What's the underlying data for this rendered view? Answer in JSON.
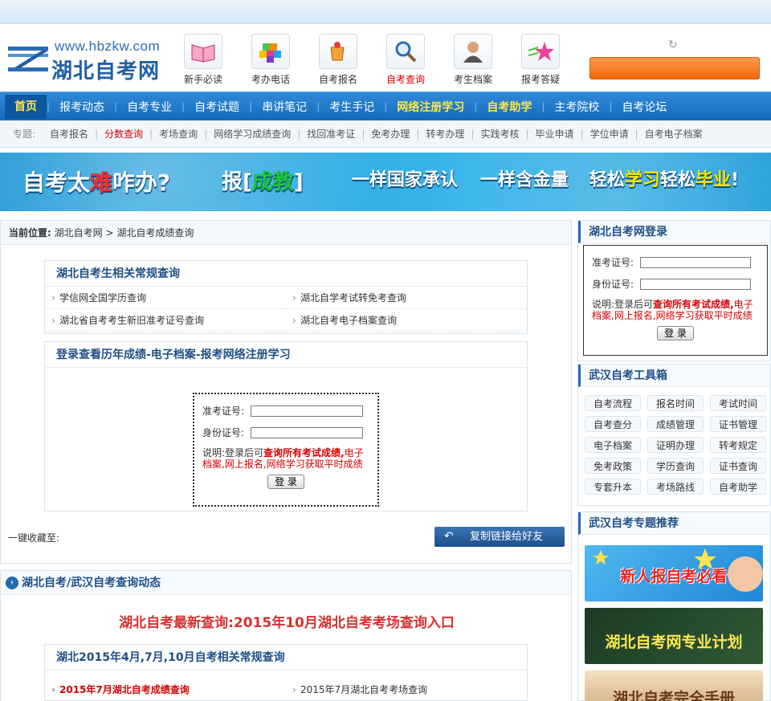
{
  "logo": {
    "url": "www.hbzkw.com",
    "name": "湖北自考网"
  },
  "quick_icons": [
    {
      "label": "新手必读",
      "icon": "book-icon"
    },
    {
      "label": "考办电话",
      "icon": "blocks-icon"
    },
    {
      "label": "自考报名",
      "icon": "cup-icon"
    },
    {
      "label": "自考查询",
      "icon": "magnifier-icon"
    },
    {
      "label": "考生档案",
      "icon": "person-icon"
    },
    {
      "label": "报考答疑",
      "icon": "star-icon"
    }
  ],
  "nav": [
    "首页",
    "报考动态",
    "自考专业",
    "自考试题",
    "串讲笔记",
    "考生手记",
    "网络注册学习",
    "自考助学",
    "主考院校",
    "自考论坛"
  ],
  "subnav": {
    "lead": "专题:",
    "items": [
      "自考报名",
      "分数查询",
      "考场查询",
      "网络学习成绩查询",
      "找回准考证",
      "免考办理",
      "转考办理",
      "实践考核",
      "毕业申请",
      "学位申请",
      "自考电子档案"
    ]
  },
  "banner": {
    "p1a": "自考太",
    "p1b": "难",
    "p1c": "咋办?",
    "p2a": "报[",
    "p2b": "成教",
    "p2c": "]",
    "p3": "一样国家承认",
    "p4": "一样含金量",
    "p5a": "轻松",
    "p5b": "学习",
    "p5c": "轻松",
    "p5d": "毕业",
    "p5e": "!"
  },
  "breadcrumb": {
    "label": "当前位置:",
    "path": "湖北自考网 > 湖北自考成绩查询"
  },
  "query_panel": {
    "title": "湖北自考生相关常规查询",
    "links": [
      "学信网全国学历查询",
      "湖北自学考试转免考查询",
      "湖北省自考考生新旧准考证号查询",
      "湖北自考电子档案查询"
    ]
  },
  "login_panel": {
    "title": "登录查看历年成绩-电子档案-报考网络注册学习",
    "id_label": "准考证号:",
    "card_label": "身份证号:",
    "note_a": "说明:登录后可",
    "note_b": "查询所有考试成绩",
    "note_c": ",",
    "note_d": "电子档案,网上报名,网络学习获取平时成绩",
    "button": "登 录"
  },
  "fav_label": "一键收藏至:",
  "copy_button": "复制链接给好友",
  "section2": {
    "title": "湖北自考/武汉自考查询动态",
    "headline": "湖北自考最新查询:2015年10月湖北自考考场查询入口",
    "sub_title": "湖北2015年4月,7月,10月自考相关常规查询",
    "links": [
      "2015年7月湖北自考成绩查询",
      "2015年7月湖北自考考场查询"
    ]
  },
  "right_login": {
    "title": "湖北自考网登录",
    "id_label": "准考证号:",
    "card_label": "身份证号:",
    "note_a": "说明:登录后可",
    "note_b": "查询所有考试成绩",
    "note_c": ",",
    "note_d": "电子档案,网上报名,网络学习获取平时成绩",
    "button": "登 录"
  },
  "tools": {
    "title": "武汉自考工具箱",
    "items": [
      "自考流程",
      "报名时间",
      "考试时间",
      "自考查分",
      "成绩管理",
      "证书管理",
      "电子档案",
      "证明办理",
      "转考规定",
      "免考政策",
      "学历查询",
      "证书查询",
      "专套升本",
      "考场路线",
      "自考助学"
    ]
  },
  "topics": {
    "title": "武汉自考专题推荐",
    "p1": "新人报自考必看",
    "p2": "湖北自考网专业计划",
    "p3": "湖北自考完全手册"
  }
}
